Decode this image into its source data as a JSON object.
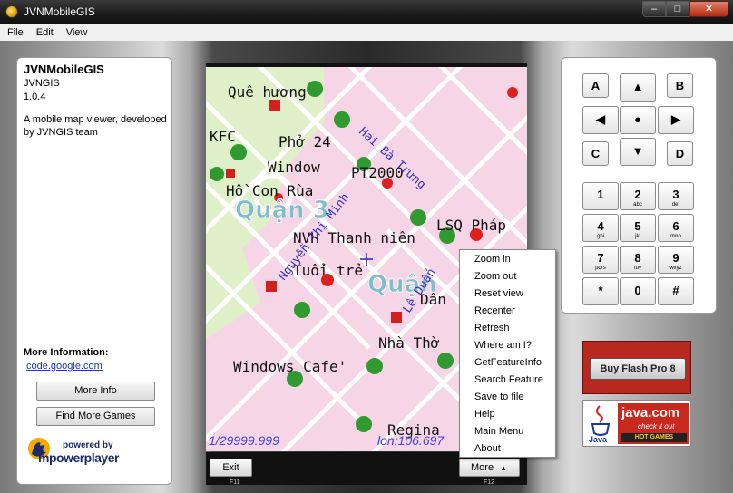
{
  "window": {
    "title": "JVNMobileGIS",
    "minimize_glyph": "–",
    "maximize_glyph": "□",
    "close_glyph": "✕"
  },
  "menubar": {
    "items": [
      "File",
      "Edit",
      "View"
    ]
  },
  "info_panel": {
    "app_name": "JVNMobileGIS",
    "vendor": "JVNGIS",
    "version": "1.0.4",
    "description": "A mobile map viewer, developed by JVNGIS team",
    "more_info_heading": "More Information:",
    "link": "code.google.com",
    "more_info_button": "More Info",
    "find_games_button": "Find More Games",
    "powered_by": "powered by",
    "brand": "mpowerplayer"
  },
  "map": {
    "labels": {
      "que_huong": "Quê hương",
      "kfc": "KFC",
      "pho24": "Phở 24",
      "window": "Window",
      "pt2000": "PT2000",
      "ho_con_rua": "Hồ Con Rùa",
      "quan3": "Quận 3",
      "lsq_phap": "LSQ Pháp",
      "nvh": "NVH Thanh niên",
      "tuoi_tre": "Tuổi trẻ",
      "quan1": "Quận",
      "nha_tho": "Nhà Thờ",
      "windows_cafe": "Windows Cafe'",
      "regina": "Regina",
      "hai_ba_trung": "Hai Bà Trưng",
      "nguyen_thi_minh": "Nguyễn Thị Minh",
      "le_duan": "Lê Duẩn",
      "dan": "Dân"
    },
    "scale": "1/29999.999",
    "coords": "lon:106.697"
  },
  "softkeys": {
    "left": "Exit",
    "right": "More",
    "right_arrow": "▲",
    "left_hint": "F11",
    "right_hint": "F12"
  },
  "popup_menu": {
    "items": [
      "Zoom in",
      "Zoom out",
      "Reset view",
      "Recenter",
      "Refresh",
      "Where am I?",
      "GetFeatureInfo",
      "Search Feature",
      "Save to file",
      "Help",
      "Main Menu",
      "About"
    ]
  },
  "keypad": {
    "top_keys": {
      "a": "A",
      "b": "B",
      "c": "C",
      "d": "D"
    },
    "nav": {
      "up": "▲",
      "down": "▼",
      "left": "◀",
      "right": "▶",
      "fire": "●"
    },
    "digits": [
      {
        "main": "1",
        "sub": ""
      },
      {
        "main": "2",
        "sub": "abc"
      },
      {
        "main": "3",
        "sub": "def"
      },
      {
        "main": "4",
        "sub": "ghi"
      },
      {
        "main": "5",
        "sub": "jkl"
      },
      {
        "main": "6",
        "sub": "mno"
      },
      {
        "main": "7",
        "sub": "pqrs"
      },
      {
        "main": "8",
        "sub": "tuv"
      },
      {
        "main": "9",
        "sub": "wxyz"
      },
      {
        "main": "*",
        "sub": ""
      },
      {
        "main": "0",
        "sub": ""
      },
      {
        "main": "#",
        "sub": ""
      }
    ]
  },
  "ads": {
    "flash_button": "Buy Flash Pro 8",
    "java_title": "java.com",
    "java_sub": "check it out",
    "java_bar": "HOT GAMES",
    "java_logo": "Java"
  },
  "colors": {
    "map_pink": "#f6d6e6",
    "map_green": "#dff0c8",
    "poi_green": "#2f9a2f",
    "pin_red": "#e02020",
    "street_blue": "#3030c0"
  }
}
